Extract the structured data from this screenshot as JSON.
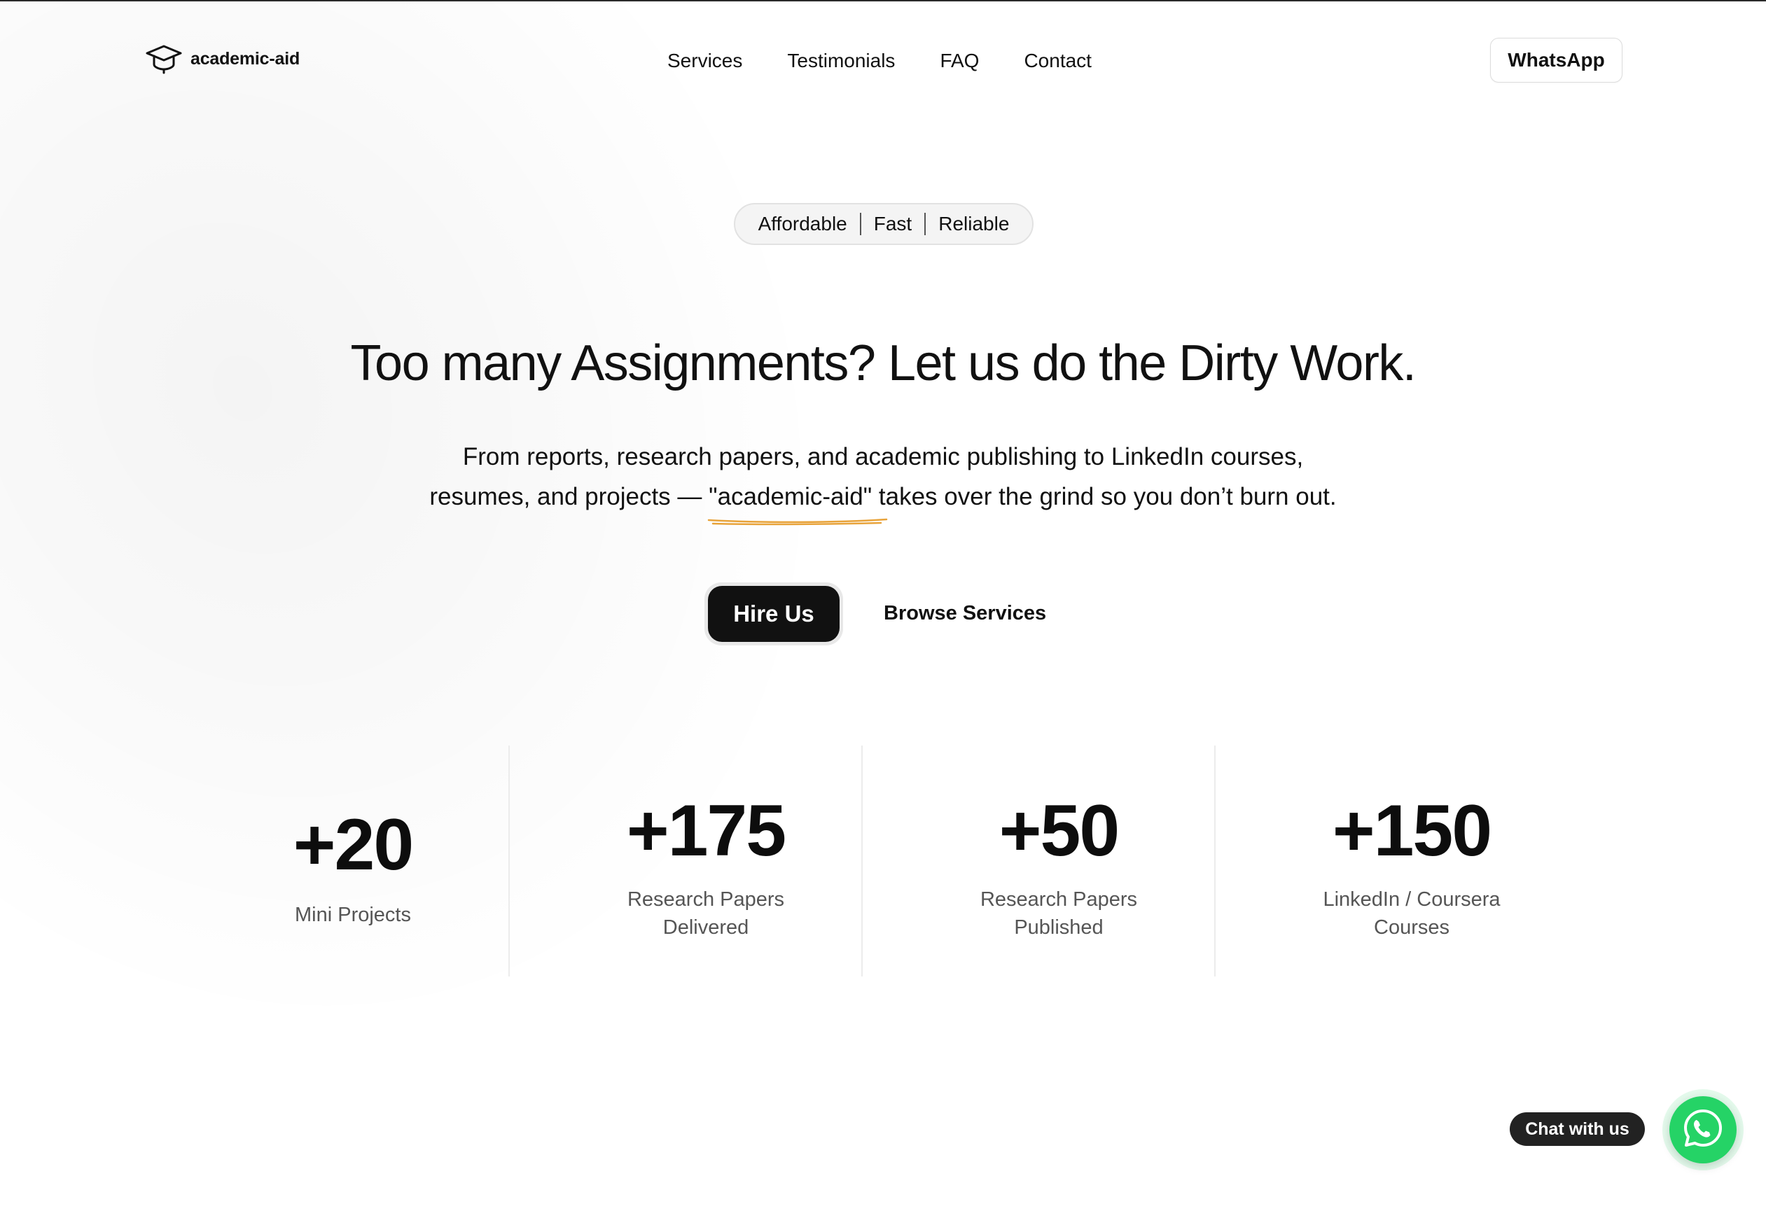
{
  "header": {
    "brand": "academic-aid",
    "brand_icon": "graduation-cap-icon",
    "nav": [
      "Services",
      "Testimonials",
      "FAQ",
      "Contact"
    ],
    "whatsapp_label": "WhatsApp"
  },
  "hero": {
    "badge": [
      "Affordable",
      "Fast",
      "Reliable"
    ],
    "headline": "Too many Assignments? Let us do the Dirty Work.",
    "sub_line1": "From reports, research papers, and academic publishing to LinkedIn courses,",
    "sub_line2_before": "resumes, and projects — ",
    "sub_highlight": "\"academic-aid\"",
    "sub_line2_after": " takes over the grind so you don’t burn out.",
    "primary_cta": "Hire Us",
    "secondary_cta": "Browse Services"
  },
  "stats": [
    {
      "value": "+20",
      "label": "Mini Projects"
    },
    {
      "value": "+175",
      "label": "Research Papers Delivered"
    },
    {
      "value": "+50",
      "label": "Research Papers Published"
    },
    {
      "value": "+150",
      "label": "LinkedIn / Coursera Courses"
    }
  ],
  "chat": {
    "label": "Chat with us",
    "icon": "whatsapp-icon"
  },
  "colors": {
    "accent_underline": "#e8a33a",
    "primary_button": "#111111",
    "whatsapp_green": "#25d366"
  }
}
